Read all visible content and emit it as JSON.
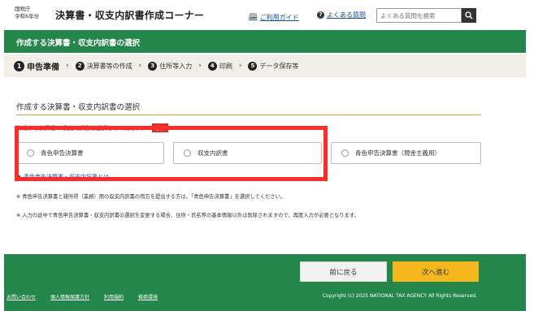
{
  "header": {
    "agency_line1": "国税庁",
    "agency_line2": "令和6年分",
    "title": "決算書・収支内訳書作成コーナー",
    "guide_label": "ご利用ガイド",
    "faq_label": "よくある質問",
    "search_placeholder": "よくある質問を検索"
  },
  "section_bar": {
    "title": "作成する決算書・収支内訳書の選択"
  },
  "steps": [
    {
      "num": "1",
      "label": "申告準備",
      "active": true
    },
    {
      "num": "2",
      "label": "決算書等の作成"
    },
    {
      "num": "3",
      "label": "住所等入力"
    },
    {
      "num": "4",
      "label": "印刷"
    },
    {
      "num": "5",
      "label": "データ保存等"
    }
  ],
  "main": {
    "section_title": "作成する決算書・収支内訳書の選択",
    "instruction": "作成する決算書・収支内訳書を選択してください。",
    "required_label": "必須",
    "options": [
      {
        "label": "青色申告決算書"
      },
      {
        "label": "収支内訳書"
      },
      {
        "label": "青色申告決算書（現金主義用）"
      }
    ],
    "link_text": "青色申告決算書・収支内訳書とは",
    "note1": "※ 青色申告決算書と雑所得（業務）用の収支内訳書の両方を提出する方は、「青色申告決算書」を選択してください。",
    "note2": "※ 入力の途中で青色申告決算書・収支内訳書の選択を変更する場合、住所・氏名等の基本情報以外は削除されますので、再度入力が必要となります。"
  },
  "footer": {
    "back_label": "前に戻る",
    "next_label": "次へ進む",
    "links": [
      "お問い合わせ",
      "個人情報保護方針",
      "利用規約",
      "推奨環境"
    ],
    "copyright": "Copyright (c) 2025 NATIONAL TAX AGENCY All Rights Reserved."
  },
  "colors": {
    "green": "#24864a",
    "next_button": "#f5b81c",
    "highlight": "#ff2a2a"
  }
}
